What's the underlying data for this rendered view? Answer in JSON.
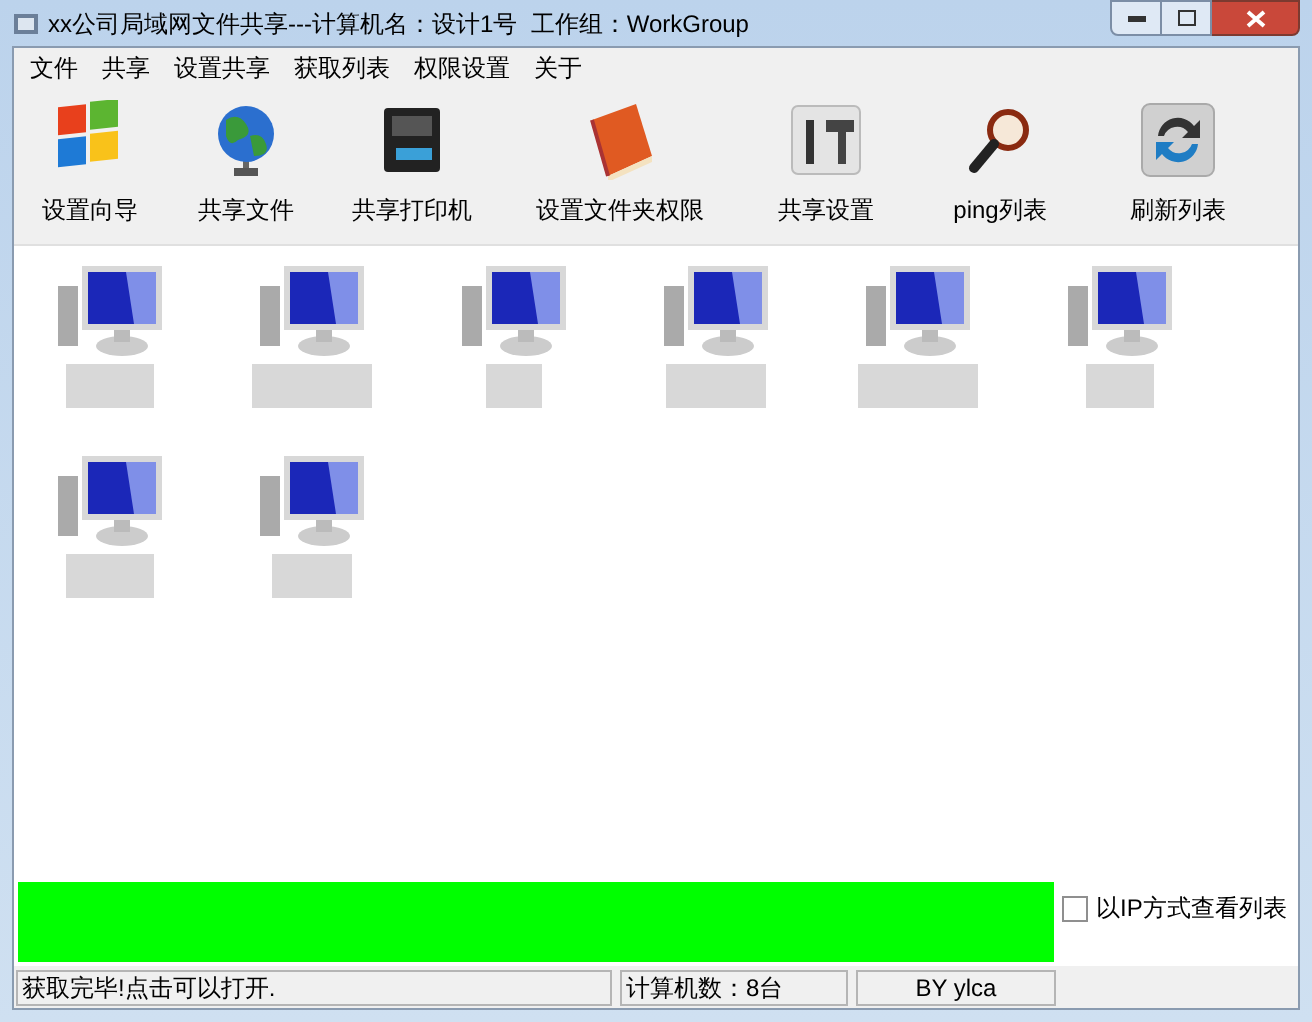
{
  "window": {
    "title": "xx公司局域网文件共享---计算机名：设计1号  工作组：WorkGroup"
  },
  "menu": [
    "文件",
    "共享",
    "设置共享",
    "获取列表",
    "权限设置",
    "关于"
  ],
  "toolbar": [
    {
      "kind": "windows",
      "label": "设置向导"
    },
    {
      "kind": "globe",
      "label": "共享文件"
    },
    {
      "kind": "printer",
      "label": "共享打印机"
    },
    {
      "kind": "book",
      "label": "设置文件夹权限"
    },
    {
      "kind": "tools",
      "label": "共享设置"
    },
    {
      "kind": "magnifier",
      "label": "ping列表"
    },
    {
      "kind": "refresh",
      "label": "刷新列表"
    }
  ],
  "computers": [
    {
      "name_redacted": true
    },
    {
      "name_redacted": true
    },
    {
      "name_redacted": true
    },
    {
      "name_redacted": true
    },
    {
      "name_redacted": true
    },
    {
      "name_redacted": true
    },
    {
      "name_redacted": true
    },
    {
      "name_redacted": true
    }
  ],
  "progress": {
    "level": 1
  },
  "view_by_ip": {
    "label": "以IP方式查看列表",
    "checked": false
  },
  "status_bar": [
    "获取完毕!点击可以打开.",
    "计算机数：8台",
    "BY ylca"
  ]
}
